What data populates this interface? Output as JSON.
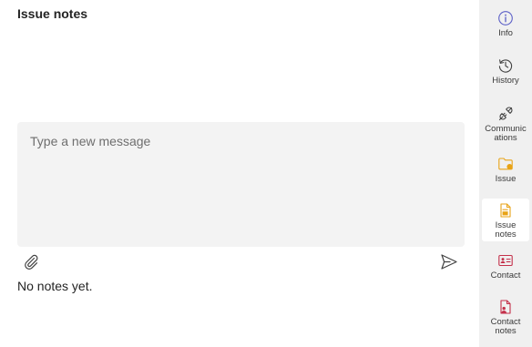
{
  "panel": {
    "title": "Issue notes",
    "composer_placeholder": "Type a new message",
    "empty_text": "No notes yet."
  },
  "icons": {
    "attach": "paperclip-icon",
    "send": "send-icon"
  },
  "rail": {
    "items": [
      {
        "label_1": "Info",
        "label_2": "",
        "icon": "info-icon",
        "color": "#5b5fc7"
      },
      {
        "label_1": "History",
        "label_2": "",
        "icon": "history-icon",
        "color": "#424242"
      },
      {
        "label_1": "Communic",
        "label_2": "ations",
        "icon": "plug-icon",
        "color": "#424242"
      },
      {
        "label_1": "Issue",
        "label_2": "",
        "icon": "folder-icon",
        "color": "#e8a317"
      },
      {
        "label_1": "Issue",
        "label_2": "notes",
        "icon": "note-icon",
        "color": "#e8a317",
        "active": true
      },
      {
        "label_1": "Contact",
        "label_2": "",
        "icon": "contact-card-icon",
        "color": "#c4314b"
      },
      {
        "label_1": "Contact",
        "label_2": "notes",
        "icon": "contact-notes-icon",
        "color": "#c4314b"
      }
    ]
  }
}
